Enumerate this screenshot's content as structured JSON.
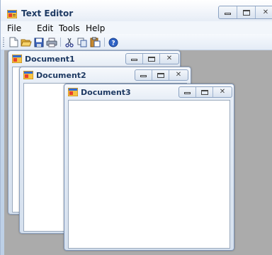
{
  "app": {
    "title": "Text Editor",
    "controls": {
      "minimize": "–",
      "maximize": "□",
      "close": "✕"
    }
  },
  "menu": [
    {
      "label": "File"
    },
    {
      "label": "Edit"
    },
    {
      "label": "Tools"
    },
    {
      "label": "Help"
    }
  ],
  "toolbar": {
    "icons": [
      "new-file-icon",
      "open-folder-icon",
      "save-icon",
      "print-icon",
      "cut-icon",
      "copy-icon",
      "paste-icon",
      "help-icon"
    ]
  },
  "documents": [
    {
      "title": "Document1"
    },
    {
      "title": "Document2"
    },
    {
      "title": "Document3"
    }
  ],
  "colors": {
    "mdi_background": "#ababab",
    "title_text": "#1e3a63",
    "frame": "#bccfe6"
  }
}
